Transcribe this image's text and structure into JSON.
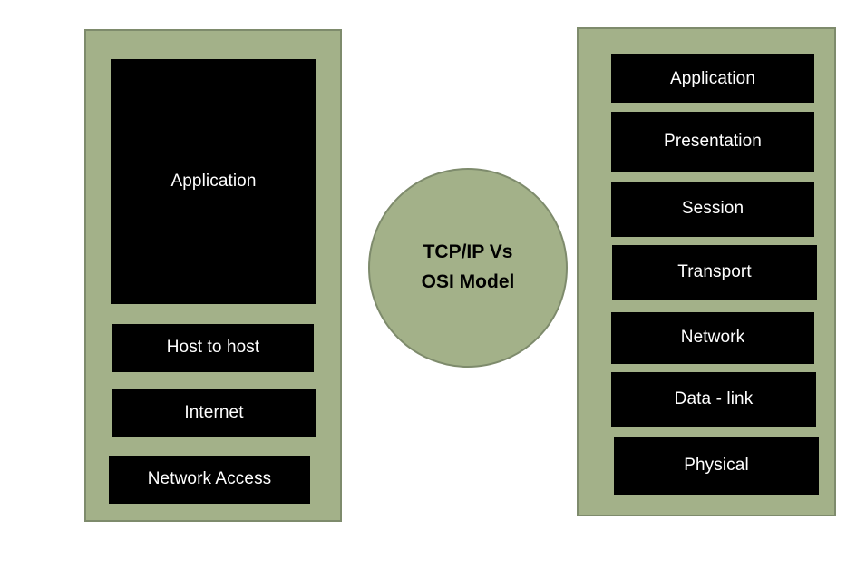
{
  "diagram": {
    "title_line1": "TCP/IP Vs",
    "title_line2": "OSI Model",
    "colors": {
      "panel_fill": "#a3b189",
      "panel_border": "#7e8b6c",
      "layer_fill": "#000000",
      "layer_text": "#ffffff",
      "title_text": "#000000",
      "background": "#ffffff"
    }
  },
  "tcpip_model": {
    "name": "TCP/IP",
    "layers": [
      {
        "label": "Application"
      },
      {
        "label": "Host to host"
      },
      {
        "label": "Internet"
      },
      {
        "label": "Network Access"
      }
    ]
  },
  "osi_model": {
    "name": "OSI",
    "layers": [
      {
        "label": "Application"
      },
      {
        "label": "Presentation"
      },
      {
        "label": "Session"
      },
      {
        "label": "Transport"
      },
      {
        "label": "Network"
      },
      {
        "label": "Data - link"
      },
      {
        "label": "Physical"
      }
    ]
  }
}
